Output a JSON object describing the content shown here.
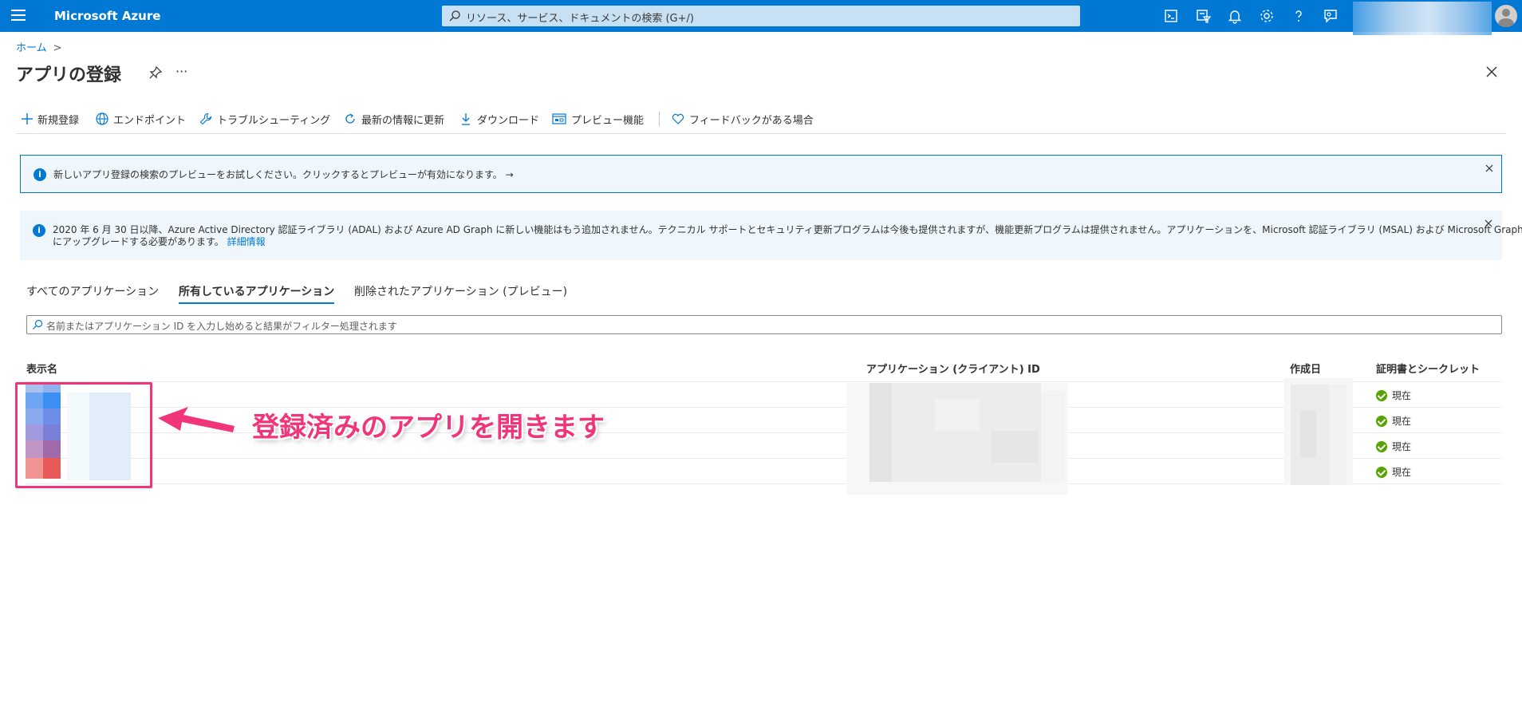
{
  "topbar": {
    "brand": "Microsoft Azure",
    "search_placeholder": "リソース、サービス、ドキュメントの検索 (G+/)",
    "icons": [
      "cloud-shell-icon",
      "directory-filter-icon",
      "notifications-icon",
      "settings-icon",
      "help-icon",
      "feedback-icon"
    ]
  },
  "breadcrumb": {
    "home": "ホーム",
    "separator": ">"
  },
  "page": {
    "title": "アプリの登録",
    "more": "···"
  },
  "toolbar": {
    "new_registration": "新規登録",
    "endpoints": "エンドポイント",
    "troubleshooting": "トラブルシューティング",
    "refresh": "最新の情報に更新",
    "download": "ダウンロード",
    "preview_features": "プレビュー機能",
    "feedback": "フィードバックがある場合"
  },
  "banners": {
    "preview": "新しいアプリ登録の検索のプレビューをお試しください。クリックするとプレビューが有効になります。 →",
    "adal_line1": "2020 年 6 月 30 日以降、Azure Active Directory 認証ライブラリ (ADAL) および Azure AD Graph に新しい機能はもう追加されません。テクニカル サポートとセキュリティ更新プログラムは今後も提供されますが、機能更新プログラムは提供されません。アプリケーションを、Microsoft 認証ライブラリ (MSAL) および Microsoft Graph",
    "adal_line2": "にアップグレードする必要があります。",
    "adal_link": "詳細情報"
  },
  "tabs": [
    {
      "label": "すべてのアプリケーション",
      "active": false
    },
    {
      "label": "所有しているアプリケーション",
      "active": true
    },
    {
      "label": "削除されたアプリケーション (プレビュー)",
      "active": false
    }
  ],
  "filter": {
    "placeholder": "名前またはアプリケーション ID を入力し始めると結果がフィルター処理されます"
  },
  "table": {
    "headers": {
      "display_name": "表示名",
      "app_id": "アプリケーション (クライアント) ID",
      "created": "作成日",
      "certs": "証明書とシークレット"
    },
    "rows": [
      {
        "cert_status": "現在"
      },
      {
        "cert_status": "現在"
      },
      {
        "cert_status": "現在"
      },
      {
        "cert_status": "現在"
      }
    ]
  },
  "annotation": {
    "text": "登録済みのアプリを開きます",
    "color": "#f0357a"
  },
  "colors": {
    "azure_blue": "#0078d4",
    "success_green": "#57a300"
  }
}
